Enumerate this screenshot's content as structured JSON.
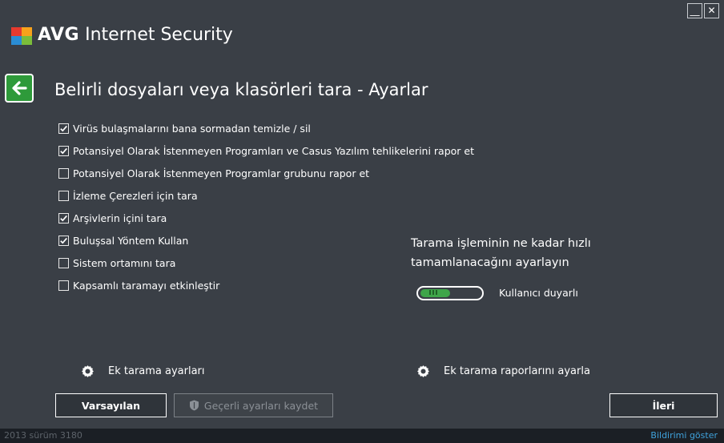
{
  "app": {
    "brand_bold": "AVG",
    "brand_rest": " Internet Security"
  },
  "window_controls": {
    "minimize": "__",
    "close": "✕"
  },
  "page": {
    "title": "Belirli dosyaları veya klasörleri tara - Ayarlar"
  },
  "options": [
    {
      "label": "Virüs bulaşmalarını bana sormadan temizle / sil",
      "checked": true
    },
    {
      "label": "Potansiyel Olarak İstenmeyen Programları ve Casus Yazılım tehlikelerini rapor et",
      "checked": true
    },
    {
      "label": "Potansiyel Olarak İstenmeyen Programlar grubunu rapor et",
      "checked": false
    },
    {
      "label": "İzleme Çerezleri için tara",
      "checked": false
    },
    {
      "label": "Arşivlerin içini tara",
      "checked": true
    },
    {
      "label": "Buluşsal Yöntem Kullan",
      "checked": true
    },
    {
      "label": "Sistem ortamını tara",
      "checked": false
    },
    {
      "label": "Kapsamlı taramayı etkinleştir",
      "checked": false
    }
  ],
  "speed": {
    "heading": "Tarama işleminin ne kadar hızlı tamamlanacağını ayarlayın",
    "value_label": "Kullanıcı duyarlı",
    "level_fraction": 0.5
  },
  "links": {
    "extra_scan_settings": "Ek tarama ayarları",
    "extra_report_settings": "Ek tarama raporlarını ayarla"
  },
  "buttons": {
    "default": "Varsayılan",
    "save_current": "Geçerli ayarları kaydet",
    "next": "İleri"
  },
  "status": {
    "version": "2013  sürüm 3180",
    "notify": "Bildirimi göster"
  },
  "colors": {
    "accent_green": "#3fa54a",
    "background": "#3a3f46",
    "link_blue": "#3fa2dc"
  }
}
